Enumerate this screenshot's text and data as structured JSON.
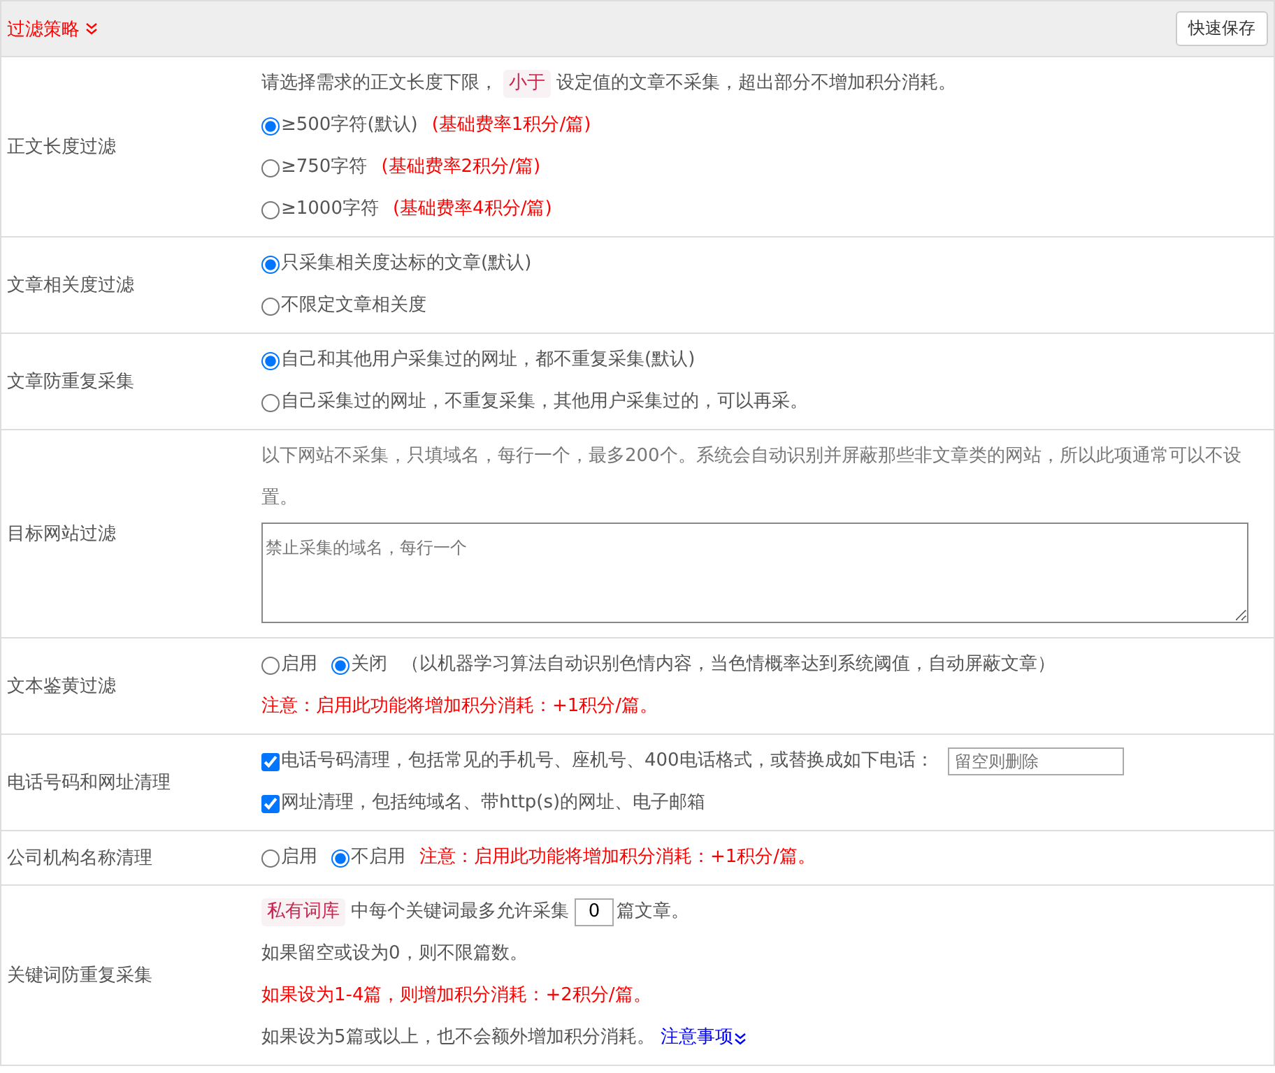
{
  "header": {
    "title": "过滤策略",
    "save_button": "快速保存"
  },
  "rows": [
    {
      "label": "正文长度过滤",
      "lines": [
        {
          "parts": [
            {
              "kind": "text",
              "text": "请选择需求的正文长度下限，"
            },
            {
              "kind": "tag",
              "text": "小于"
            },
            {
              "kind": "text",
              "text": "设定值的文章不采集，超出部分不增加积分消耗。"
            }
          ]
        },
        {
          "parts": [
            {
              "kind": "radio",
              "label": "≥500字符(默认)",
              "selected": true
            },
            {
              "kind": "warning",
              "text": "(基础费率1积分/篇)"
            }
          ]
        },
        {
          "parts": [
            {
              "kind": "radio",
              "label": "≥750字符",
              "selected": false
            },
            {
              "kind": "warning",
              "text": "(基础费率2积分/篇)"
            }
          ]
        },
        {
          "parts": [
            {
              "kind": "radio",
              "label": "≥1000字符",
              "selected": false
            },
            {
              "kind": "warning",
              "text": "(基础费率4积分/篇)"
            }
          ]
        }
      ]
    },
    {
      "label": "文章相关度过滤",
      "lines": [
        {
          "parts": [
            {
              "kind": "radio",
              "label": "只采集相关度达标的文章(默认)",
              "selected": true
            }
          ]
        },
        {
          "parts": [
            {
              "kind": "radio",
              "label": "不限定文章相关度",
              "selected": false
            }
          ]
        }
      ]
    },
    {
      "label": "文章防重复采集",
      "lines": [
        {
          "parts": [
            {
              "kind": "radio",
              "label": "自己和其他用户采集过的网址，都不重复采集(默认)",
              "selected": true
            }
          ]
        },
        {
          "parts": [
            {
              "kind": "radio",
              "label": "自己采集过的网址，不重复采集，其他用户采集过的，可以再采。",
              "selected": false
            }
          ]
        }
      ]
    },
    {
      "label": "目标网站过滤",
      "lines": [
        {
          "parts": [
            {
              "kind": "hint",
              "text": "以下网站不采集，只填域名，每行一个，最多200个。系统会自动识别并屏蔽那些非文章类的网站，所以此项通常可以不设置。"
            }
          ]
        },
        {
          "parts": [
            {
              "kind": "textarea",
              "placeholder": "禁止采集的域名，每行一个"
            }
          ]
        }
      ]
    },
    {
      "label": "文本鉴黄过滤",
      "lines": [
        {
          "parts": [
            {
              "kind": "radio",
              "label": "启用",
              "selected": false
            },
            {
              "kind": "radio",
              "label": "关闭",
              "selected": true
            },
            {
              "kind": "text",
              "text": "（以机器学习算法自动识别色情内容，当色情概率达到系统阈值，自动屏蔽文章）"
            }
          ]
        },
        {
          "parts": [
            {
              "kind": "warning",
              "text": "注意：启用此功能将增加积分消耗：+1积分/篇。"
            }
          ]
        }
      ]
    },
    {
      "label": "电话号码和网址清理",
      "lines": [
        {
          "parts": [
            {
              "kind": "checkbox",
              "label": "电话号码清理，包括常见的手机号、座机号、400电话格式，或替换成如下电话：",
              "checked": true
            },
            {
              "kind": "input",
              "placeholder": "留空则删除"
            }
          ]
        },
        {
          "parts": [
            {
              "kind": "checkbox",
              "label": "网址清理，包括纯域名、带http(s)的网址、电子邮箱",
              "checked": true
            }
          ]
        }
      ]
    },
    {
      "label": "公司机构名称清理",
      "lines": [
        {
          "parts": [
            {
              "kind": "radio",
              "label": "启用",
              "selected": false
            },
            {
              "kind": "radio",
              "label": "不启用",
              "selected": true
            },
            {
              "kind": "warning",
              "text": "注意：启用此功能将增加积分消耗：+1积分/篇。"
            }
          ]
        }
      ]
    },
    {
      "label": "关键词防重复采集",
      "lines": [
        {
          "parts": [
            {
              "kind": "tag",
              "text": "私有词库"
            },
            {
              "kind": "text",
              "text": "中每个关键词最多允许采集"
            },
            {
              "kind": "number",
              "value": "0"
            },
            {
              "kind": "text",
              "text": "篇文章。"
            }
          ]
        },
        {
          "parts": [
            {
              "kind": "text",
              "text": "如果留空或设为0，则不限篇数。"
            }
          ]
        },
        {
          "parts": [
            {
              "kind": "warning",
              "text": "如果设为1-4篇，则增加积分消耗：+2积分/篇。"
            }
          ]
        },
        {
          "parts": [
            {
              "kind": "text",
              "text": "如果设为5篇或以上，也不会额外增加积分消耗。"
            },
            {
              "kind": "link",
              "text": "注意事项"
            }
          ]
        }
      ]
    }
  ]
}
